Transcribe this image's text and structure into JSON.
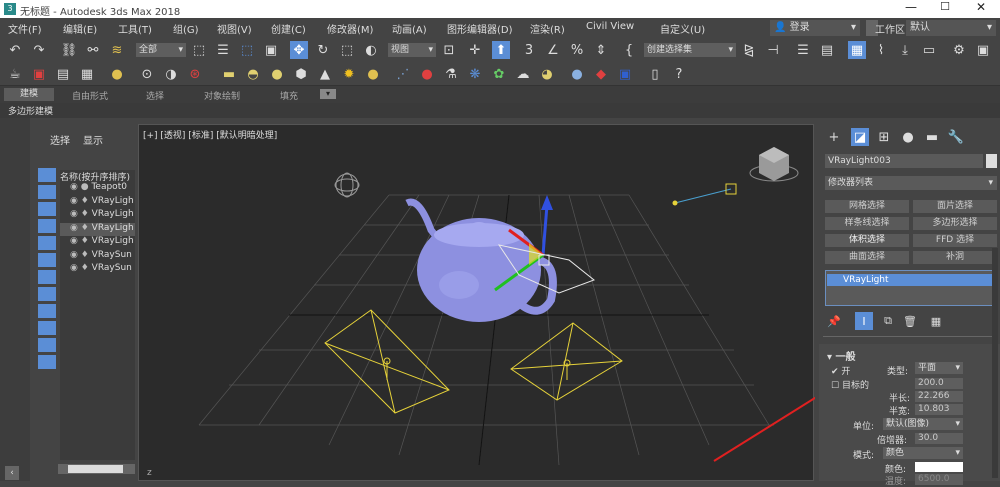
{
  "window": {
    "title": "无标题 - Autodesk 3ds Max 2018"
  },
  "menu": [
    "文件(F)",
    "编辑(E)",
    "工具(T)",
    "组(G)",
    "视图(V)",
    "创建(C)",
    "修改器(M)",
    "动画(A)",
    "图形编辑器(D)",
    "渲染(R)",
    "Civil View",
    "自定义(U)"
  ],
  "account": {
    "login": "登录",
    "workspace_label": "工作区:",
    "workspace_value": "默认"
  },
  "toolbar": {
    "filter": "全部",
    "view_dropdown": "视图",
    "selection_set": "创建选择集"
  },
  "ribbon": {
    "tabs": [
      "建模",
      "自由形式",
      "选择",
      "对象绘制",
      "填充"
    ],
    "sub": "多边形建模"
  },
  "scene": {
    "tabs": [
      "选择",
      "显示"
    ],
    "header": "名称(按升序排序)",
    "items": [
      "Teapot0",
      "VRayLigh",
      "VRayLigh",
      "VRayLigh",
      "VRayLigh",
      "VRaySun",
      "VRaySun"
    ],
    "selected_index": 3
  },
  "viewport": {
    "label": "[+] [透视] [标准] [默认明暗处理]",
    "axis": "z"
  },
  "command": {
    "object_name": "VRayLight003",
    "modifier_list": "修改器列表",
    "mod_buttons": [
      "网格选择",
      "面片选择",
      "样条线选择",
      "多边形选择",
      "体积选择",
      "FFD 选择",
      "曲面选择",
      "补洞"
    ],
    "stack_item": "VRayLight",
    "rollout_title": "一般",
    "on_label": "开",
    "type_label": "类型:",
    "type_value": "平面",
    "target_label": "目标的",
    "target_value": "200.0",
    "half_len_label": "半长:",
    "half_len_value": "22.266",
    "half_wid_label": "半宽:",
    "half_wid_value": "10.803",
    "units_label": "单位:",
    "units_value": "默认(图像)",
    "multiplier_label": "倍增器:",
    "multiplier_value": "30.0",
    "mode_label": "模式:",
    "mode_value": "颜色",
    "color_label": "颜色:",
    "temp_label": "温度:",
    "temp_value": "6500.0"
  },
  "colors": {
    "accent": "#5b8ed6",
    "light_gizmo": "#e6d23a",
    "teapot": "#8d90e0",
    "arrow": "#e02020"
  }
}
